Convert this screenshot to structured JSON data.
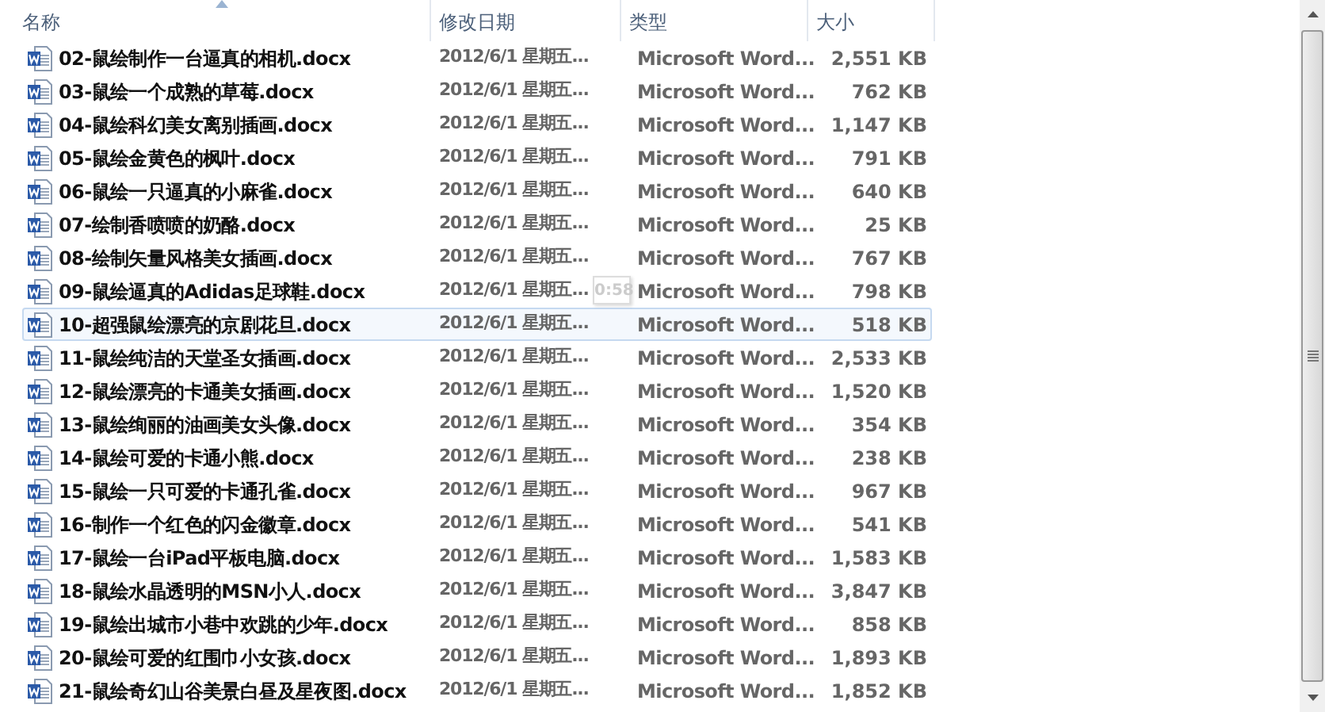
{
  "columns": [
    {
      "label": "名称",
      "sorted": true
    },
    {
      "label": "修改日期",
      "sorted": false
    },
    {
      "label": "类型",
      "sorted": false
    },
    {
      "label": "大小",
      "sorted": false
    }
  ],
  "rows": [
    {
      "name": "02-鼠绘制作一台逼真的相机.docx",
      "date": "2012/6/1 星期五...",
      "type": "Microsoft Word...",
      "size": "2,551 KB",
      "selected": false
    },
    {
      "name": "03-鼠绘一个成熟的草莓.docx",
      "date": "2012/6/1 星期五...",
      "type": "Microsoft Word...",
      "size": "762 KB",
      "selected": false
    },
    {
      "name": "04-鼠绘科幻美女离别插画.docx",
      "date": "2012/6/1 星期五...",
      "type": "Microsoft Word...",
      "size": "1,147 KB",
      "selected": false
    },
    {
      "name": "05-鼠绘金黄色的枫叶.docx",
      "date": "2012/6/1 星期五...",
      "type": "Microsoft Word...",
      "size": "791 KB",
      "selected": false
    },
    {
      "name": "06-鼠绘一只逼真的小麻雀.docx",
      "date": "2012/6/1 星期五...",
      "type": "Microsoft Word...",
      "size": "640 KB",
      "selected": false
    },
    {
      "name": "07-绘制香喷喷的奶酪.docx",
      "date": "2012/6/1 星期五...",
      "type": "Microsoft Word...",
      "size": "25 KB",
      "selected": false
    },
    {
      "name": "08-绘制矢量风格美女插画.docx",
      "date": "2012/6/1 星期五...",
      "type": "Microsoft Word...",
      "size": "767 KB",
      "selected": false
    },
    {
      "name": "09-鼠绘逼真的Adidas足球鞋.docx",
      "date": "2012/6/1 星期五...",
      "type": "Microsoft Word...",
      "size": "798 KB",
      "selected": false,
      "tooltip": "0:58"
    },
    {
      "name": "10-超强鼠绘漂亮的京剧花旦.docx",
      "date": "2012/6/1 星期五...",
      "type": "Microsoft Word...",
      "size": "518 KB",
      "selected": true
    },
    {
      "name": "11-鼠绘纯洁的天堂圣女插画.docx",
      "date": "2012/6/1 星期五...",
      "type": "Microsoft Word...",
      "size": "2,533 KB",
      "selected": false
    },
    {
      "name": "12-鼠绘漂亮的卡通美女插画.docx",
      "date": "2012/6/1 星期五...",
      "type": "Microsoft Word...",
      "size": "1,520 KB",
      "selected": false
    },
    {
      "name": "13-鼠绘绚丽的油画美女头像.docx",
      "date": "2012/6/1 星期五...",
      "type": "Microsoft Word...",
      "size": "354 KB",
      "selected": false
    },
    {
      "name": "14-鼠绘可爱的卡通小熊.docx",
      "date": "2012/6/1 星期五...",
      "type": "Microsoft Word...",
      "size": "238 KB",
      "selected": false
    },
    {
      "name": "15-鼠绘一只可爱的卡通孔雀.docx",
      "date": "2012/6/1 星期五...",
      "type": "Microsoft Word...",
      "size": "967 KB",
      "selected": false
    },
    {
      "name": "16-制作一个红色的闪金徽章.docx",
      "date": "2012/6/1 星期五...",
      "type": "Microsoft Word...",
      "size": "541 KB",
      "selected": false
    },
    {
      "name": "17-鼠绘一台iPad平板电脑.docx",
      "date": "2012/6/1 星期五...",
      "type": "Microsoft Word...",
      "size": "1,583 KB",
      "selected": false
    },
    {
      "name": "18-鼠绘水晶透明的MSN小人.docx",
      "date": "2012/6/1 星期五...",
      "type": "Microsoft Word...",
      "size": "3,847 KB",
      "selected": false
    },
    {
      "name": "19-鼠绘出城市小巷中欢跳的少年.docx",
      "date": "2012/6/1 星期五...",
      "type": "Microsoft Word...",
      "size": "858 KB",
      "selected": false
    },
    {
      "name": "20-鼠绘可爱的红围巾小女孩.docx",
      "date": "2012/6/1 星期五...",
      "type": "Microsoft Word...",
      "size": "1,893 KB",
      "selected": false
    },
    {
      "name": "21-鼠绘奇幻山谷美景白昼及星夜图.docx",
      "date": "2012/6/1 星期五...",
      "type": "Microsoft Word...",
      "size": "1,852 KB",
      "selected": false
    }
  ]
}
